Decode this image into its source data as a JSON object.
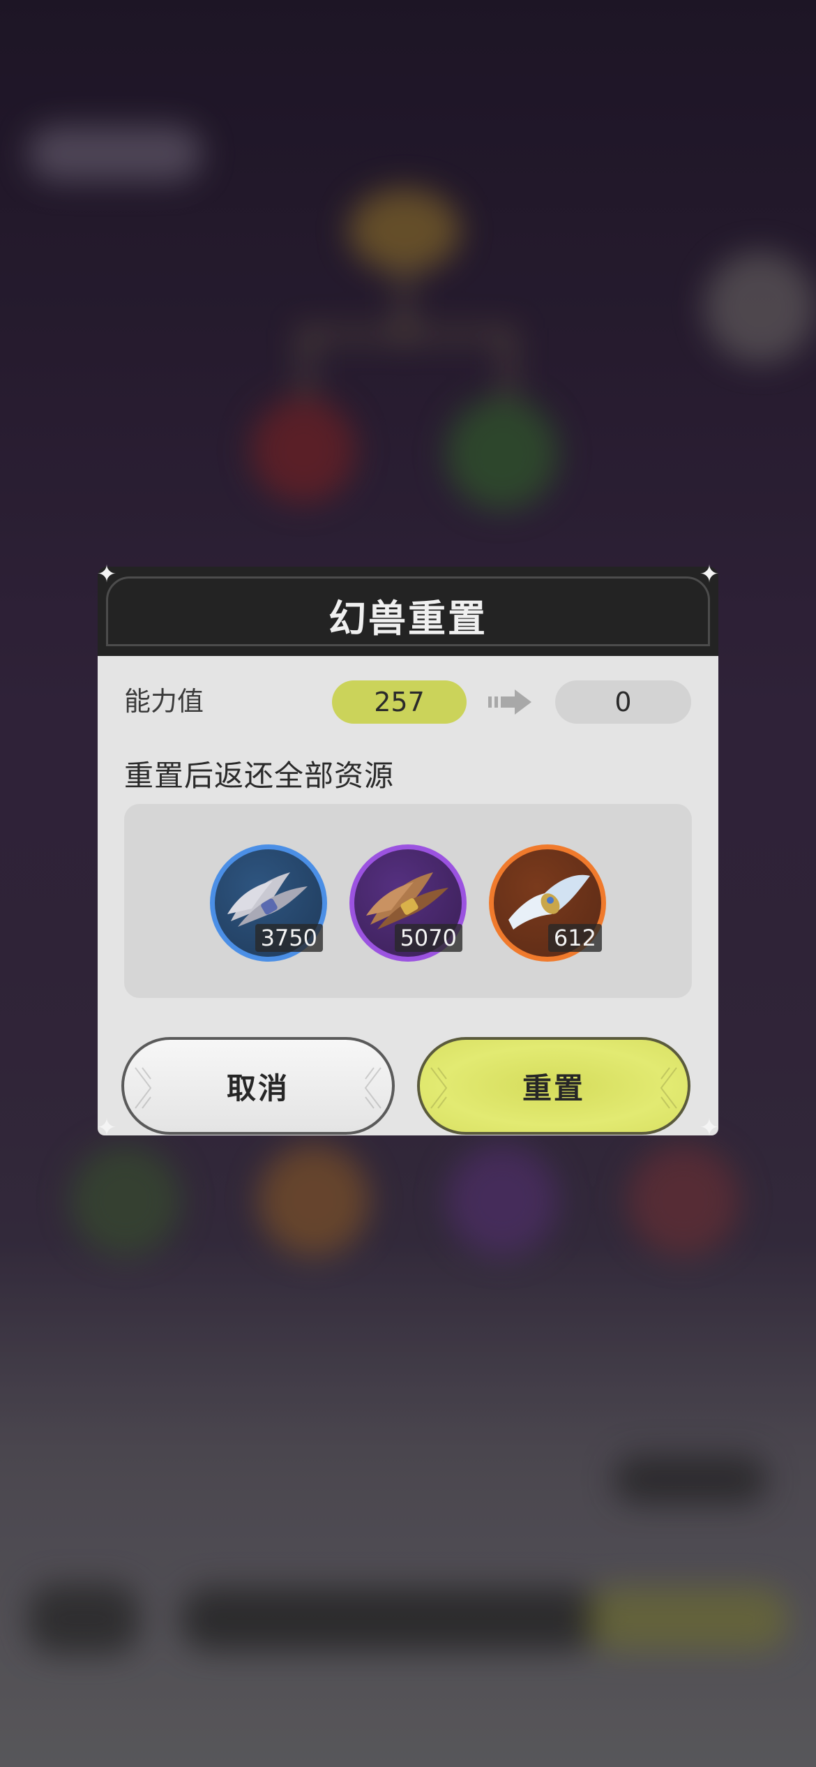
{
  "dialog": {
    "title": "幻兽重置",
    "ability_label": "能力值",
    "ability_current": "257",
    "ability_after": "0",
    "description": "重置后返还全部资源",
    "resources": [
      {
        "name": "gray-feather-bundle-icon",
        "count": "3750",
        "ring_color": "#4b8fe6",
        "disc_color": "#1f3a5a"
      },
      {
        "name": "brown-feather-bundle-icon",
        "count": "5070",
        "ring_color": "#9b53e0",
        "disc_color": "#3a1f55"
      },
      {
        "name": "white-scroll-bundle-icon",
        "count": "612",
        "ring_color": "#f07a2c",
        "disc_color": "#5a2a16"
      }
    ],
    "cancel_label": "取消",
    "confirm_label": "重置"
  },
  "colors": {
    "accent": "#cbd35a",
    "header": "#232323",
    "body": "#e4e4e4"
  }
}
